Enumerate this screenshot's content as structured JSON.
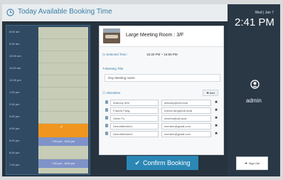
{
  "header": {
    "title": "Today Available Booking Time"
  },
  "timeline": {
    "labels": [
      "8:00 am",
      "9:00 am",
      "10:00 am",
      "11:00 am",
      "12:00 pm",
      "1:00 pm",
      "2:00 pm",
      "3:00 pm",
      "4:00 pm",
      "5:00 pm",
      "6:00 pm",
      "7:00 pm"
    ],
    "booked": [
      "7:00 pm - 8:00 pm",
      "7:00 pm - 8:00 pm"
    ]
  },
  "room": {
    "name": "Large Meeting Room : 3/F"
  },
  "selected_time": {
    "label": "Selected Time :",
    "value": "16:30 PM ~ 16:59 PM"
  },
  "meeting_title": {
    "label": "Meeting Title",
    "value": "Day Meeting name"
  },
  "attendees": {
    "label": "Attendees",
    "add_label": "Add",
    "rows": [
      {
        "name": "Anthony Whl",
        "email": "anthony@cdl.local"
      },
      {
        "name": "Francis Fang",
        "email": "francis.fang@cdl.local"
      },
      {
        "name": "Oliver Fu",
        "email": "oliverfu@cdl.local"
      },
      {
        "name": "DemoMember1",
        "email": "member@gmail.com"
      },
      {
        "name": "DemoMember2",
        "email": "member@gmail.com"
      }
    ]
  },
  "confirm_label": "Confirm Booking",
  "side": {
    "date": "Wed | Jan 7",
    "clock": "2:41 PM",
    "user": "admin",
    "signout_label": "Sign Out"
  },
  "colors": {
    "accent": "#2b87b5",
    "selected": "#f0961f",
    "booked": "#7f93c8",
    "slot": "#c7ccb6"
  }
}
